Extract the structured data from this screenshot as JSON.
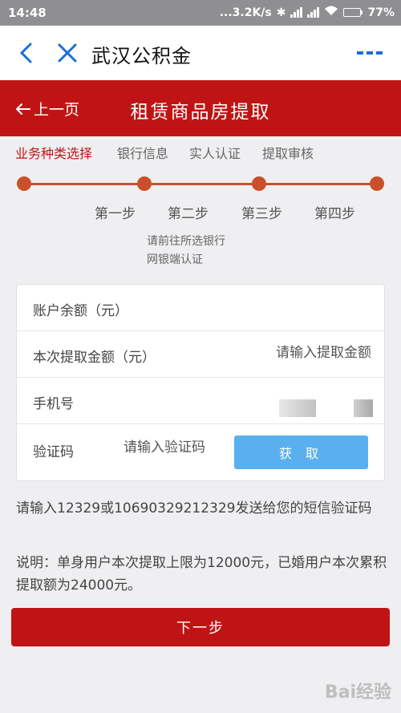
{
  "status_bar": {
    "time": "14:48",
    "network_speed": "...3.2K/s",
    "battery": "77%",
    "battery_level": 0.77
  },
  "app_bar": {
    "title": "武汉公积金"
  },
  "header": {
    "back_label": "上一页",
    "title": "租赁商品房提取"
  },
  "tabs": [
    "业务种类选择",
    "银行信息",
    "实人认证",
    "提取审核"
  ],
  "steps": [
    "第一步",
    "第二步",
    "第三步",
    "第四步"
  ],
  "note_lines": [
    "请前往所选银行",
    "网银端认证"
  ],
  "form": {
    "balance_label": "账户余额（元）",
    "amount_label": "本次提取金额（元）",
    "amount_placeholder": "请输入提取金额",
    "phone_label": "手机号",
    "code_label": "验证码",
    "code_placeholder": "请输入验证码",
    "get_code_label": "获 取"
  },
  "hints": [
    "请输入12329或10690329212329发送给您的短信验证码",
    "说明：单身用户本次提取上限为12000元，已婚用户本次累积提取额为24000元。"
  ],
  "next_label": "下一步",
  "watermark": "Bai经验",
  "colors": {
    "primary_red": "#c01414",
    "step_orange": "#c9502a",
    "button_blue": "#5ab0ef",
    "link_blue": "#1a6fd6"
  }
}
